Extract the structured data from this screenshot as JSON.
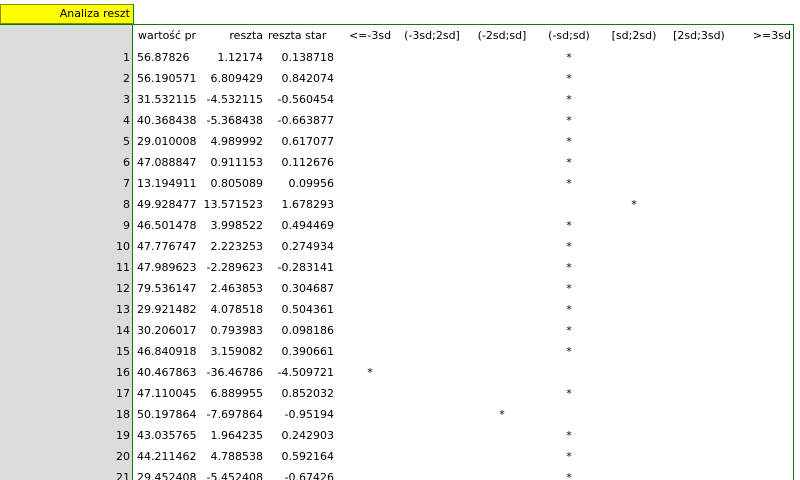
{
  "sheet_tab": "Analiza reszt",
  "columns": {
    "c1": "wartość pr",
    "c2": "reszta",
    "c3": "reszta star",
    "s1": "<=-3sd",
    "s2": "(-3sd;2sd]",
    "s3": "(-2sd;sd]",
    "s4": "(-sd;sd)",
    "s5": "[sd;2sd)",
    "s6": "[2sd;3sd)",
    "s7": ">=3sd"
  },
  "rows": [
    {
      "n": "1",
      "fit": "56.87826",
      "res": "1.12174",
      "std": "0.138718",
      "bin": 4
    },
    {
      "n": "2",
      "fit": "56.190571",
      "res": "6.809429",
      "std": "0.842074",
      "bin": 4
    },
    {
      "n": "3",
      "fit": "31.532115",
      "res": "-4.532115",
      "std": "-0.560454",
      "bin": 4
    },
    {
      "n": "4",
      "fit": "40.368438",
      "res": "-5.368438",
      "std": "-0.663877",
      "bin": 4
    },
    {
      "n": "5",
      "fit": "29.010008",
      "res": "4.989992",
      "std": "0.617077",
      "bin": 4
    },
    {
      "n": "6",
      "fit": "47.088847",
      "res": "0.911153",
      "std": "0.112676",
      "bin": 4
    },
    {
      "n": "7",
      "fit": "13.194911",
      "res": "0.805089",
      "std": "0.09956",
      "bin": 4
    },
    {
      "n": "8",
      "fit": "49.928477",
      "res": "13.571523",
      "std": "1.678293",
      "bin": 5
    },
    {
      "n": "9",
      "fit": "46.501478",
      "res": "3.998522",
      "std": "0.494469",
      "bin": 4
    },
    {
      "n": "10",
      "fit": "47.776747",
      "res": "2.223253",
      "std": "0.274934",
      "bin": 4
    },
    {
      "n": "11",
      "fit": "47.989623",
      "res": "-2.289623",
      "std": "-0.283141",
      "bin": 4
    },
    {
      "n": "12",
      "fit": "79.536147",
      "res": "2.463853",
      "std": "0.304687",
      "bin": 4
    },
    {
      "n": "13",
      "fit": "29.921482",
      "res": "4.078518",
      "std": "0.504361",
      "bin": 4
    },
    {
      "n": "14",
      "fit": "30.206017",
      "res": "0.793983",
      "std": "0.098186",
      "bin": 4
    },
    {
      "n": "15",
      "fit": "46.840918",
      "res": "3.159082",
      "std": "0.390661",
      "bin": 4
    },
    {
      "n": "16",
      "fit": "40.467863",
      "res": "-36.46786",
      "std": "-4.509721",
      "bin": 1
    },
    {
      "n": "17",
      "fit": "47.110045",
      "res": "6.889955",
      "std": "0.852032",
      "bin": 4
    },
    {
      "n": "18",
      "fit": "50.197864",
      "res": "-7.697864",
      "std": "-0.95194",
      "bin": 3
    },
    {
      "n": "19",
      "fit": "43.035765",
      "res": "1.964235",
      "std": "0.242903",
      "bin": 4
    },
    {
      "n": "20",
      "fit": "44.211462",
      "res": "4.788538",
      "std": "0.592164",
      "bin": 4
    },
    {
      "n": "21",
      "fit": "29.452408",
      "res": "-5.452408",
      "std": "-0.67426",
      "bin": 4
    }
  ],
  "marker": "*"
}
